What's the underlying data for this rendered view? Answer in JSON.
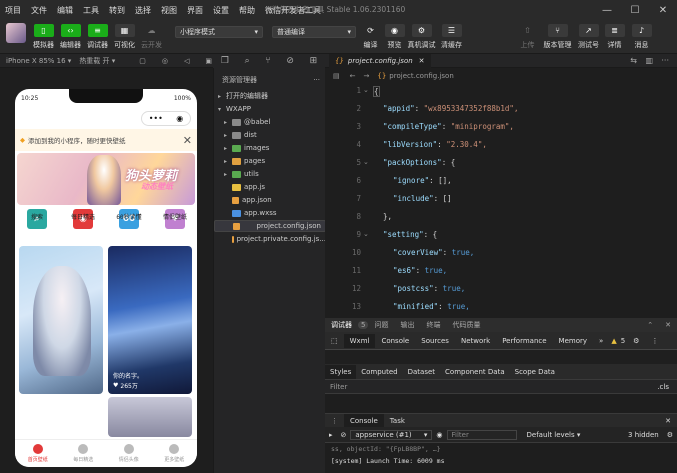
{
  "menubar": {
    "items": [
      "项目",
      "文件",
      "编辑",
      "工具",
      "转到",
      "选择",
      "视图",
      "界面",
      "设置",
      "帮助",
      "微信开发者工具"
    ],
    "window_title": "微信开发者工具 Stable 1.06.2301160",
    "controls": [
      "—",
      "☐",
      "✕"
    ]
  },
  "toolbar": {
    "simulator": "模拟器",
    "editor": "编辑器",
    "debugger": "调试器",
    "visual": "可视化",
    "cloud": "云开发",
    "mode_select": "小程序模式",
    "compile_select": "普通编译",
    "compile": "编译",
    "preview": "预览",
    "real_debug": "真机调试",
    "clear_cache": "清缓存",
    "upload": "上传",
    "version": "版本管理",
    "test": "测试号",
    "detail": "详情",
    "message": "消息"
  },
  "subbar": {
    "device": "iPhone X 85% 16 ▾",
    "hotreload": "热重载 开 ▾"
  },
  "phone": {
    "time": "10:25",
    "battery": "100%",
    "capsule_dots": "•••",
    "capsule_target": "◉",
    "notice": "添加到我的小程序，随时更快壁纸",
    "banner_title": "狗头萝莉",
    "banner_sub": "动态壁纸",
    "categories": [
      {
        "label": "搜索",
        "icon": "⌕",
        "color": "#2aa8a0"
      },
      {
        "label": "每日精选",
        "icon": "◉",
        "color": "#e23a3a"
      },
      {
        "label": "60秒读懂",
        "icon": "60",
        "color": "#3aa0e0"
      },
      {
        "label": "情侣壁纸",
        "icon": "♥",
        "color": "#c080d0"
      }
    ],
    "card1_caption": "",
    "card1_likes": "",
    "card2_caption": "你的名字。",
    "card2_likes": "265万",
    "tabs": [
      "首页壁纸",
      "每日精选",
      "情侣头像",
      "更多壁纸"
    ]
  },
  "explorer": {
    "title": "资源管理器",
    "open_editors": "打开的编辑器",
    "project": "WXAPP",
    "items": [
      {
        "name": "@babel",
        "type": "folder"
      },
      {
        "name": "dist",
        "type": "folder"
      },
      {
        "name": "images",
        "type": "folder"
      },
      {
        "name": "pages",
        "type": "folder"
      },
      {
        "name": "utils",
        "type": "folder"
      },
      {
        "name": "app.js",
        "type": "js"
      },
      {
        "name": "app.json",
        "type": "json"
      },
      {
        "name": "app.wxss",
        "type": "wxss"
      },
      {
        "name": "project.config.json",
        "type": "json"
      },
      {
        "name": "project.private.config.js...",
        "type": "json"
      }
    ]
  },
  "editor": {
    "tab": "project.config.json",
    "breadcrumb": "project.config.json",
    "lines": [
      {
        "n": "1",
        "t": "{"
      },
      {
        "n": "2",
        "k": "\"appid\"",
        "v": "\"wx8953347352f88b1d\","
      },
      {
        "n": "3",
        "k": "\"compileType\"",
        "v": "\"miniprogram\","
      },
      {
        "n": "4",
        "k": "\"libVersion\"",
        "v": "\"2.30.4\","
      },
      {
        "n": "5",
        "k": "\"packOptions\"",
        "v": "{"
      },
      {
        "n": "6",
        "k": "\"ignore\"",
        "v": "[],"
      },
      {
        "n": "7",
        "k": "\"include\"",
        "v": "[]"
      },
      {
        "n": "8",
        "t": "},"
      },
      {
        "n": "9",
        "k": "\"setting\"",
        "v": "{"
      },
      {
        "n": "10",
        "k": "\"coverView\"",
        "v": "true,"
      },
      {
        "n": "11",
        "k": "\"es6\"",
        "v": "true,"
      },
      {
        "n": "12",
        "k": "\"postcss\"",
        "v": "true,"
      },
      {
        "n": "13",
        "k": "\"minified\"",
        "v": "true,"
      }
    ]
  },
  "devtools": {
    "tabs_top": [
      "调试器",
      "5",
      "问题",
      "输出",
      "终端",
      "代码质量"
    ],
    "tabs": [
      "Wxml",
      "Console",
      "Sources",
      "Network",
      "Performance",
      "Memory",
      "»"
    ],
    "warn_count": "5",
    "styles_tabs": [
      "Styles",
      "Computed",
      "Dataset",
      "Component Data",
      "Scope Data"
    ],
    "filter": "Filter",
    "cls": ".cls",
    "console_tabs": [
      "Console",
      "Task"
    ],
    "context": "appservice (#1)",
    "console_filter": "Filter",
    "levels": "Default levels",
    "hidden": "3 hidden",
    "out1": "ss, objectId: \"{FpLB8BP\", …}",
    "out2": "[system] Launch Time: 6009 ms"
  }
}
